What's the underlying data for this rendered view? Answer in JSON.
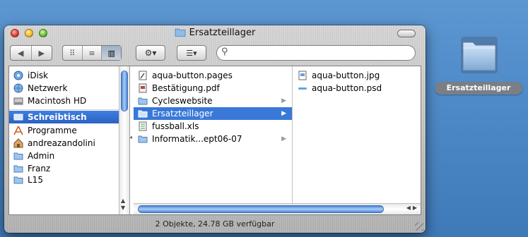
{
  "window": {
    "title": "Ersatzteillager",
    "toolbar": {
      "back_label": "◀",
      "forward_label": "▶",
      "view_icons_label": "⠿",
      "view_list_label": "≡",
      "view_columns_label": "▥",
      "action_label": "⚙▾",
      "arrange_label": "☰▾",
      "search": {
        "value": "",
        "placeholder": ""
      }
    },
    "status": "2 Objekte, 24.78 GB verfügbar"
  },
  "sidebar": {
    "items": [
      {
        "label": "iDisk",
        "icon": "idisk-icon"
      },
      {
        "label": "Netzwerk",
        "icon": "network-icon"
      },
      {
        "label": "Macintosh HD",
        "icon": "harddisk-icon"
      },
      {
        "label": "Schreibtisch",
        "icon": "desktop-icon",
        "selected": true
      },
      {
        "label": "Programme",
        "icon": "applications-icon"
      },
      {
        "label": "andreazandolini",
        "icon": "home-icon"
      },
      {
        "label": "Admin",
        "icon": "folder-icon"
      },
      {
        "label": "Franz",
        "icon": "folder-icon"
      },
      {
        "label": "L15",
        "icon": "folder-icon"
      }
    ]
  },
  "column2": {
    "items": [
      {
        "label": "aqua-button.pages",
        "icon": "pages-document-icon",
        "has_children": false
      },
      {
        "label": "Bestätigung.pdf",
        "icon": "pdf-document-icon",
        "has_children": false
      },
      {
        "label": "Cycleswebsite",
        "icon": "folder-icon",
        "has_children": true
      },
      {
        "label": "Ersatzteillager",
        "icon": "folder-icon",
        "has_children": true,
        "selected": true
      },
      {
        "label": "fussball.xls",
        "icon": "spreadsheet-icon",
        "has_children": false
      },
      {
        "label": "Informatik...ept06-07",
        "icon": "folder-icon",
        "has_children": true
      }
    ]
  },
  "column3": {
    "items": [
      {
        "label": "aqua-button.jpg",
        "icon": "jpg-image-icon"
      },
      {
        "label": "aqua-button.psd",
        "icon": "psd-image-icon"
      }
    ]
  },
  "desktop": {
    "icon_label": "Ersatzteillager"
  },
  "colors": {
    "desktop": "#4f8bc9",
    "selection": "#3a78d8",
    "label_bg": "#7a7f86"
  }
}
